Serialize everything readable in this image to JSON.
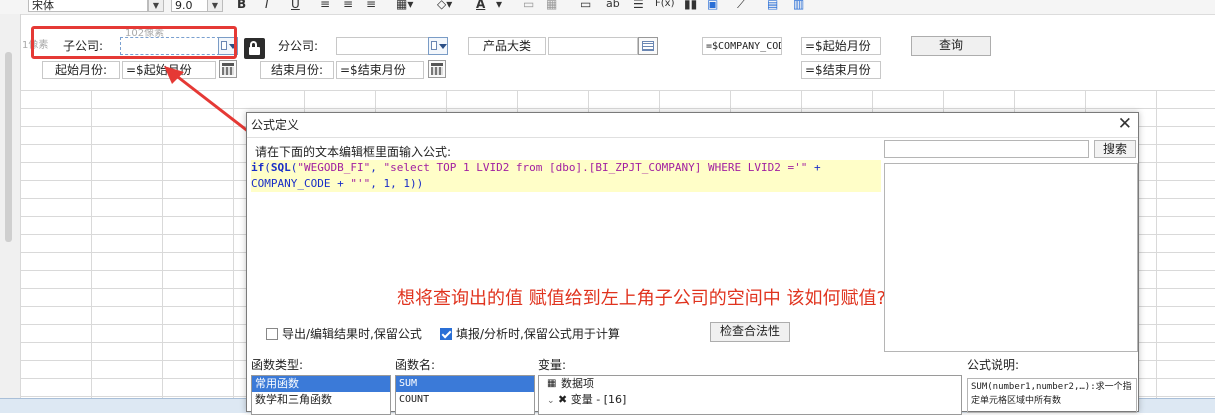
{
  "toolbar": {
    "font_name": "宋体",
    "font_size": "9.0",
    "bold": "B",
    "italic": "I",
    "underline": "U",
    "text_color_icon": "A",
    "text_tool": "ab",
    "formula_tool": "F(x)"
  },
  "ruler": {
    "left_label": "1像素",
    "top_label": "102像素"
  },
  "form": {
    "subsidiary_label": "子公司:",
    "branch_label": "分公司:",
    "product_label": "产品大类",
    "company_code_value": "=$COMPANY_COD",
    "start_month_value_right": "=$起始月份",
    "end_month_value_right": "=$结束月份",
    "query_button": "查询",
    "start_month_label": "起始月份:",
    "start_month_value": "=$起始月份",
    "end_month_label": "结束月份:",
    "end_month_value": "=$结束月份"
  },
  "dialog": {
    "title": "公式定义",
    "close": "✕",
    "instruction": "请在下面的文本编辑框里面输入公式:",
    "code": {
      "t1": "if",
      "t2": "(",
      "t3": "SQL",
      "t4": "(",
      "t5": "\"WEGODB_FI\"",
      "t6": ", ",
      "t7": "\"select TOP 1 LVID2 from [dbo].[BI_ZPJT_COMPANY] WHERE LVID2 ='\"",
      "t8": " +",
      "t9": "COMPANY_CODE + ",
      "t10": "\"'\"",
      "t11": ", 1, 1))"
    },
    "annotation": "想将查询出的值 赋值给到左上角子公司的空间中 该如何赋值?",
    "search_button": "搜索",
    "search_value": "",
    "export_keep_label": "导出/编辑结果时,保留公式",
    "export_keep_checked": false,
    "fill_keep_label": "填报/分析时,保留公式用于计算",
    "fill_keep_checked": true,
    "validate_button": "检查合法性",
    "func_type_label": "函数类型:",
    "func_type_items": [
      "常用函数",
      "数学和三角函数"
    ],
    "func_name_label": "函数名:",
    "func_name_items": [
      "SUM",
      "COUNT"
    ],
    "variable_label": "变量:",
    "variable_items": [
      "数据项",
      "变量 - [16]"
    ],
    "formula_desc_label": "公式说明:",
    "formula_desc": "SUM(number1,number2,…):求一个指定单元格区域中所有数"
  },
  "colors": {
    "annotation_red": "#e0341f",
    "highlight_yellow": "#fffec8",
    "selection_blue": "#3b7ad8",
    "callout_red": "#e53935"
  }
}
